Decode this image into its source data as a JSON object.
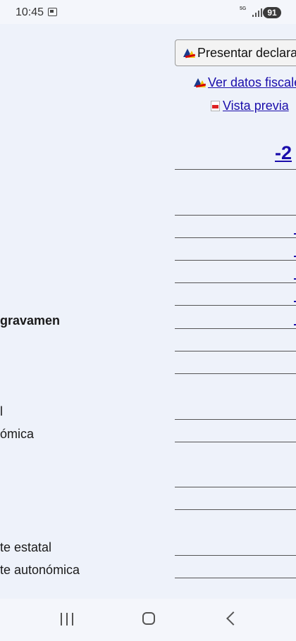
{
  "status_bar": {
    "time": "10:45",
    "network": "5G",
    "battery": "91"
  },
  "toolbar": {
    "present_label": "Presentar declaración",
    "view_fiscal_label": "Ver datos fiscales",
    "preview_label": "Vista previa"
  },
  "summary": {
    "total_value": "-2"
  },
  "rows": {
    "r1_label": "gravamen",
    "r2_label": "l",
    "r3_label": "ómica",
    "r4_label": "te estatal",
    "r5_label": "te autonómica"
  },
  "colors": {
    "background": "#eef2fa",
    "link": "#1a0dab"
  }
}
